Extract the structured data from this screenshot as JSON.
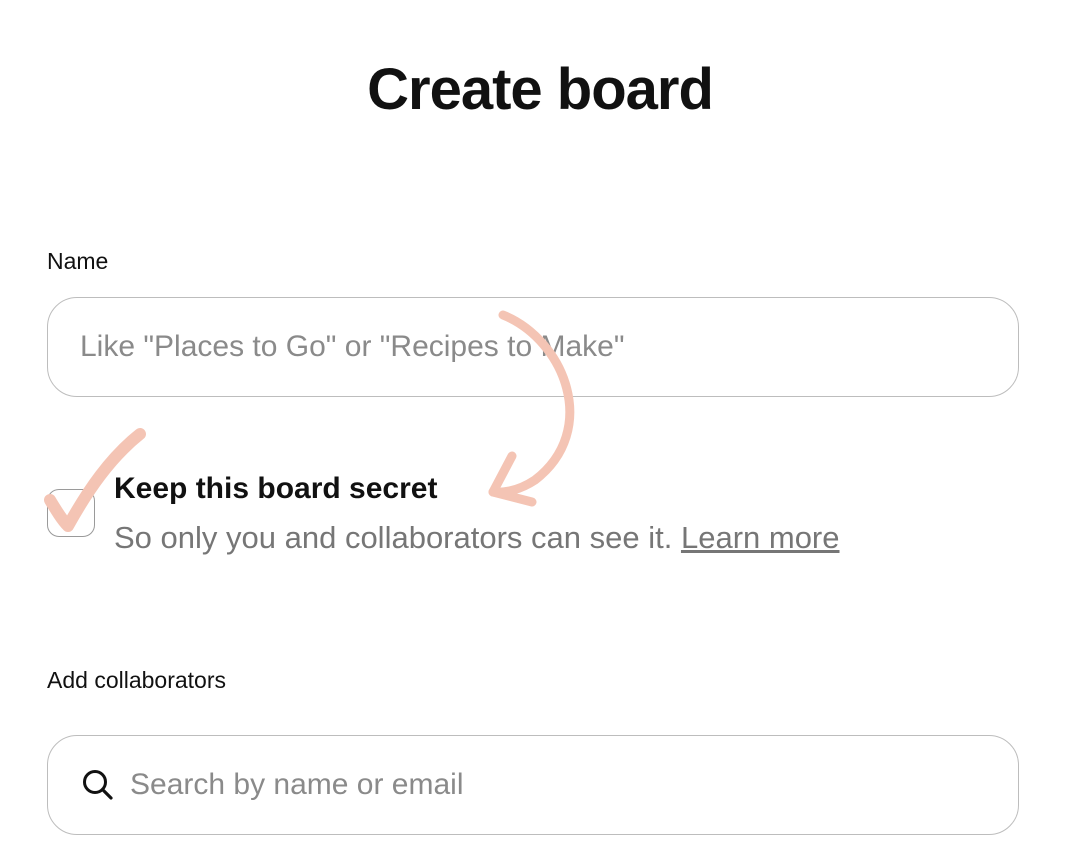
{
  "dialog": {
    "title": "Create board"
  },
  "name_field": {
    "label": "Name",
    "placeholder": "Like \"Places to Go\" or \"Recipes to Make\"",
    "value": ""
  },
  "secret_option": {
    "title": "Keep this board secret",
    "description": "So only you and collaborators can see it.",
    "learn_more_label": "Learn more",
    "checked": false
  },
  "collaborators_field": {
    "label": "Add collaborators",
    "placeholder": "Search by name or email",
    "value": "",
    "icon": "search-icon"
  },
  "annotations": {
    "color": "#f4c4b4",
    "icons": [
      "checkmark-annotation-icon",
      "curved-arrow-annotation-icon"
    ]
  }
}
